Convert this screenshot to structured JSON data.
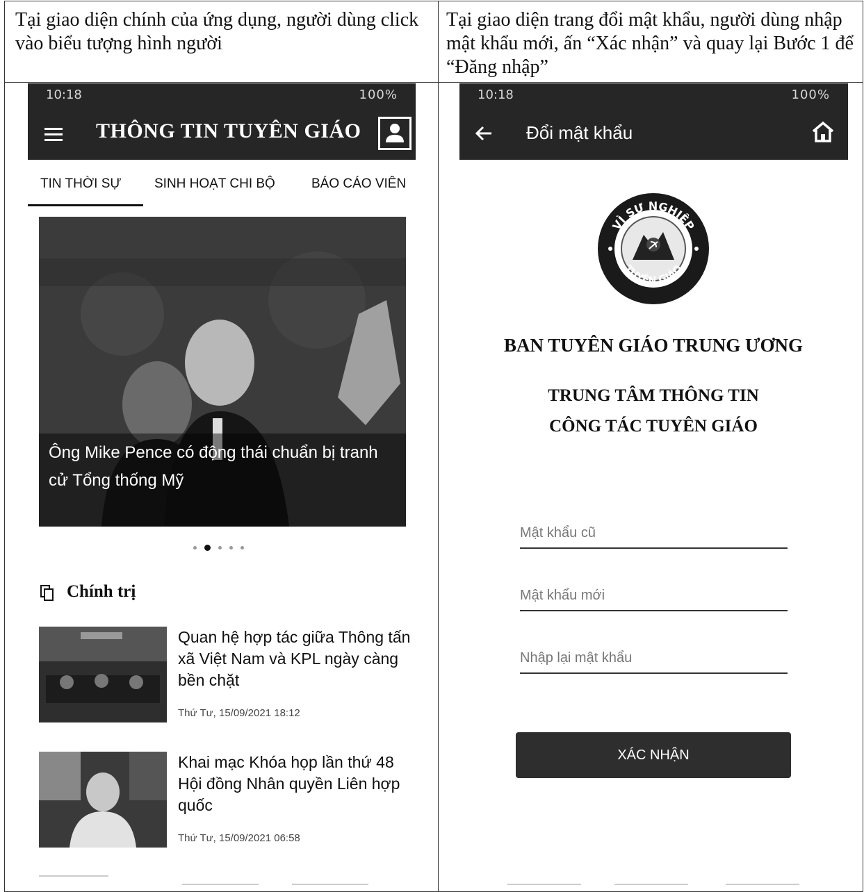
{
  "captions": {
    "left": "Tại giao diện chính của ứng dụng, người dùng click vào biểu tượng hình người",
    "right": "Tại giao diện trang đổi mật khẩu, người dùng nhập mật khẩu mới, ấn “Xác nhận” và quay lại Bước 1 để “Đăng nhập”"
  },
  "left_phone": {
    "status_time": "10:18",
    "status_right": "100%",
    "app_title": "THÔNG TIN TUYÊN GIÁO",
    "tabs": [
      {
        "label": "TIN THỜI SỰ"
      },
      {
        "label": "SINH HOẠT CHI BỘ"
      },
      {
        "label": "BÁO CÁO VIÊN"
      }
    ],
    "hero_headline": "Ông Mike Pence có động thái chuẩn bị tranh cử Tổng thống Mỹ",
    "section_title": "Chính trị",
    "news": [
      {
        "title": "Quan hệ hợp tác giữa Thông tấn xã Việt Nam và KPL ngày càng bền chặt",
        "date": "Thứ Tư, 15/09/2021 18:12"
      },
      {
        "title": "Khai mạc Khóa họp lần thứ 48 Hội đồng Nhân quyền Liên hợp quốc",
        "date": "Thứ Tư, 15/09/2021 06:58"
      }
    ]
  },
  "right_phone": {
    "status_time": "10:18",
    "status_right": "100%",
    "app_title": "Đổi mật khẩu",
    "logo_text_top": "VÌ SỰ NGHIỆP",
    "logo_text_bottom": "TUYÊN GIÁO",
    "org_line1": "BAN TUYÊN GIÁO TRUNG ƯƠNG",
    "org_line2": "TRUNG TÂM THÔNG TIN",
    "org_line3": "CÔNG TÁC TUYÊN GIÁO",
    "fields": [
      {
        "placeholder": "Mật khẩu cũ"
      },
      {
        "placeholder": "Mật khẩu mới"
      },
      {
        "placeholder": "Nhập lại mật khẩu"
      }
    ],
    "confirm_label": "XÁC NHẬN"
  }
}
